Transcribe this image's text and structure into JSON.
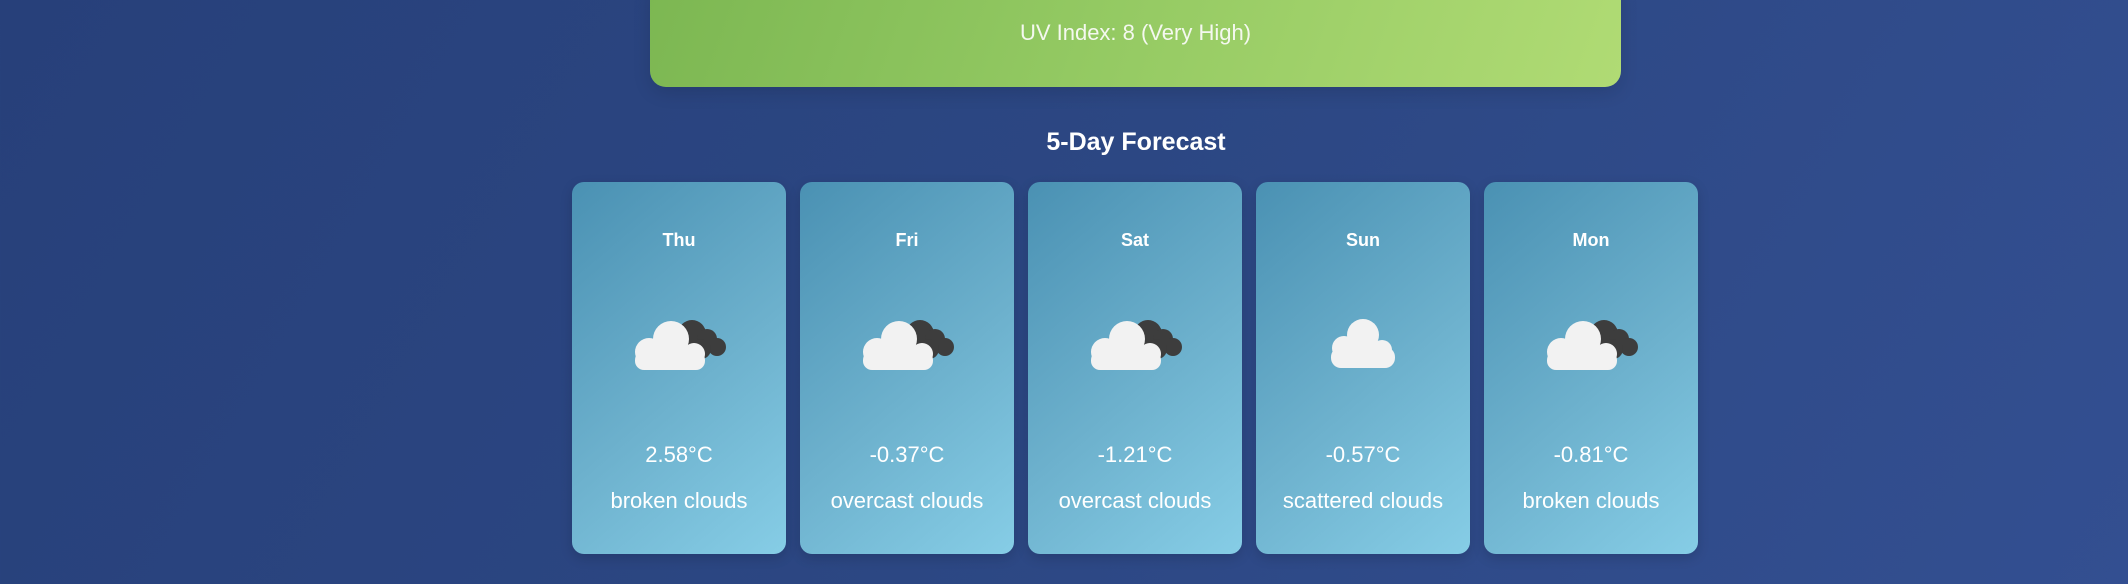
{
  "uv": {
    "text": "UV Index: 8 (Very High)"
  },
  "forecast": {
    "title": "5-Day Forecast",
    "days": [
      {
        "day": "Thu",
        "temp": "2.58°C",
        "desc": "broken clouds",
        "icon": "broken-clouds-icon"
      },
      {
        "day": "Fri",
        "temp": "-0.37°C",
        "desc": "overcast clouds",
        "icon": "overcast-clouds-icon"
      },
      {
        "day": "Sat",
        "temp": "-1.21°C",
        "desc": "overcast clouds",
        "icon": "overcast-clouds-icon"
      },
      {
        "day": "Sun",
        "temp": "-0.57°C",
        "desc": "scattered clouds",
        "icon": "scattered-clouds-icon"
      },
      {
        "day": "Mon",
        "temp": "-0.81°C",
        "desc": "broken clouds",
        "icon": "broken-clouds-icon"
      }
    ]
  },
  "colors": {
    "background": "#2c4783",
    "uv_banner": "#93c962",
    "card": "#6db1cd"
  }
}
